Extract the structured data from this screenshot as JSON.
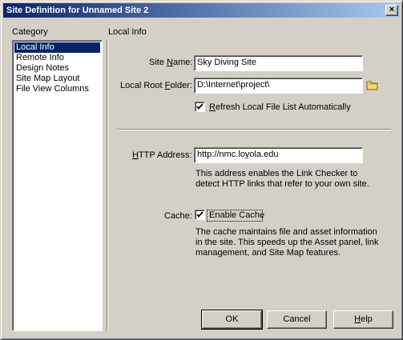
{
  "window": {
    "title": "Site Definition for Unnamed Site 2",
    "close_glyph": "×"
  },
  "category": {
    "heading": "Category",
    "items": [
      "Local Info",
      "Remote Info",
      "Design Notes",
      "Site Map Layout",
      "File View Columns"
    ],
    "selected_index": 0
  },
  "local_info": {
    "heading": "Local Info",
    "site_name_label": "Site Name:",
    "site_name_value": "Sky Diving Site",
    "local_root_label": "Local Root Folder:",
    "local_root_value": "D:\\Internet\\project\\",
    "refresh_label": "Refresh Local File List Automatically",
    "refresh_checked": true,
    "http_label": "HTTP Address:",
    "http_value": "http://nmc.loyola.edu",
    "http_note": "This address enables the Link Checker to detect HTTP links that refer to your own site.",
    "cache_label": "Cache:",
    "cache_checkbox_label": "Enable Cache",
    "cache_checked": true,
    "cache_note": "The cache maintains file and asset information in the site.  This speeds up the Asset panel, link management, and Site Map features."
  },
  "buttons": {
    "ok": "OK",
    "cancel": "Cancel",
    "help": "Help"
  },
  "colors": {
    "title_start": "#0a246a",
    "title_end": "#a6caf0",
    "face": "#d4d0c8",
    "selection": "#0a246a",
    "folder_icon": "#f5d76e"
  },
  "icons": {
    "folder": "folder-icon",
    "check": "checkmark-icon",
    "close": "close-icon"
  }
}
